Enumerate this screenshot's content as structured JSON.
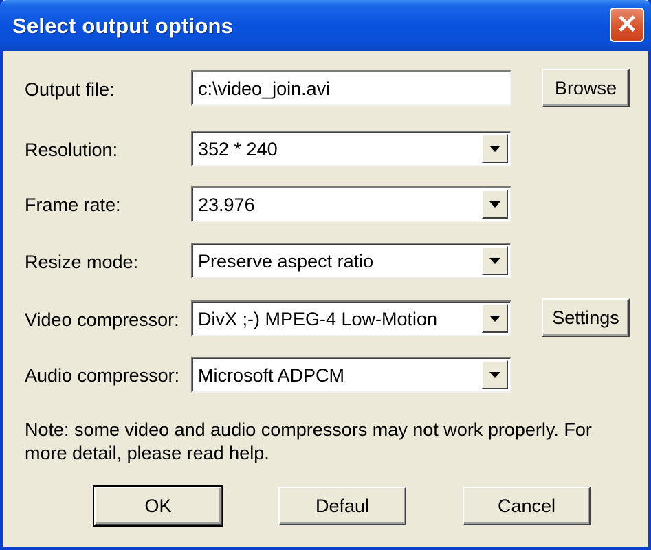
{
  "window": {
    "title": "Select output options"
  },
  "fields": {
    "output_file": {
      "label": "Output file:",
      "value": "c:\\video_join.avi"
    },
    "resolution": {
      "label": "Resolution:",
      "value": "352 * 240"
    },
    "frame_rate": {
      "label": "Frame rate:",
      "value": "23.976"
    },
    "resize_mode": {
      "label": "Resize mode:",
      "value": "Preserve aspect ratio"
    },
    "video_compressor": {
      "label": "Video compressor:",
      "value": "DivX ;-) MPEG-4 Low-Motion"
    },
    "audio_compressor": {
      "label": "Audio compressor:",
      "value": "Microsoft ADPCM"
    }
  },
  "buttons": {
    "browse": "Browse",
    "settings": "Settings",
    "ok": "OK",
    "default": "Defaul",
    "cancel": "Cancel",
    "close": "✕"
  },
  "note": "Note: some video and audio compressors may not work properly. For more detail, please read help.",
  "colors": {
    "title_bar": "#0a53de",
    "dialog_bg": "#ece9d8",
    "close_button": "#d8532c"
  }
}
